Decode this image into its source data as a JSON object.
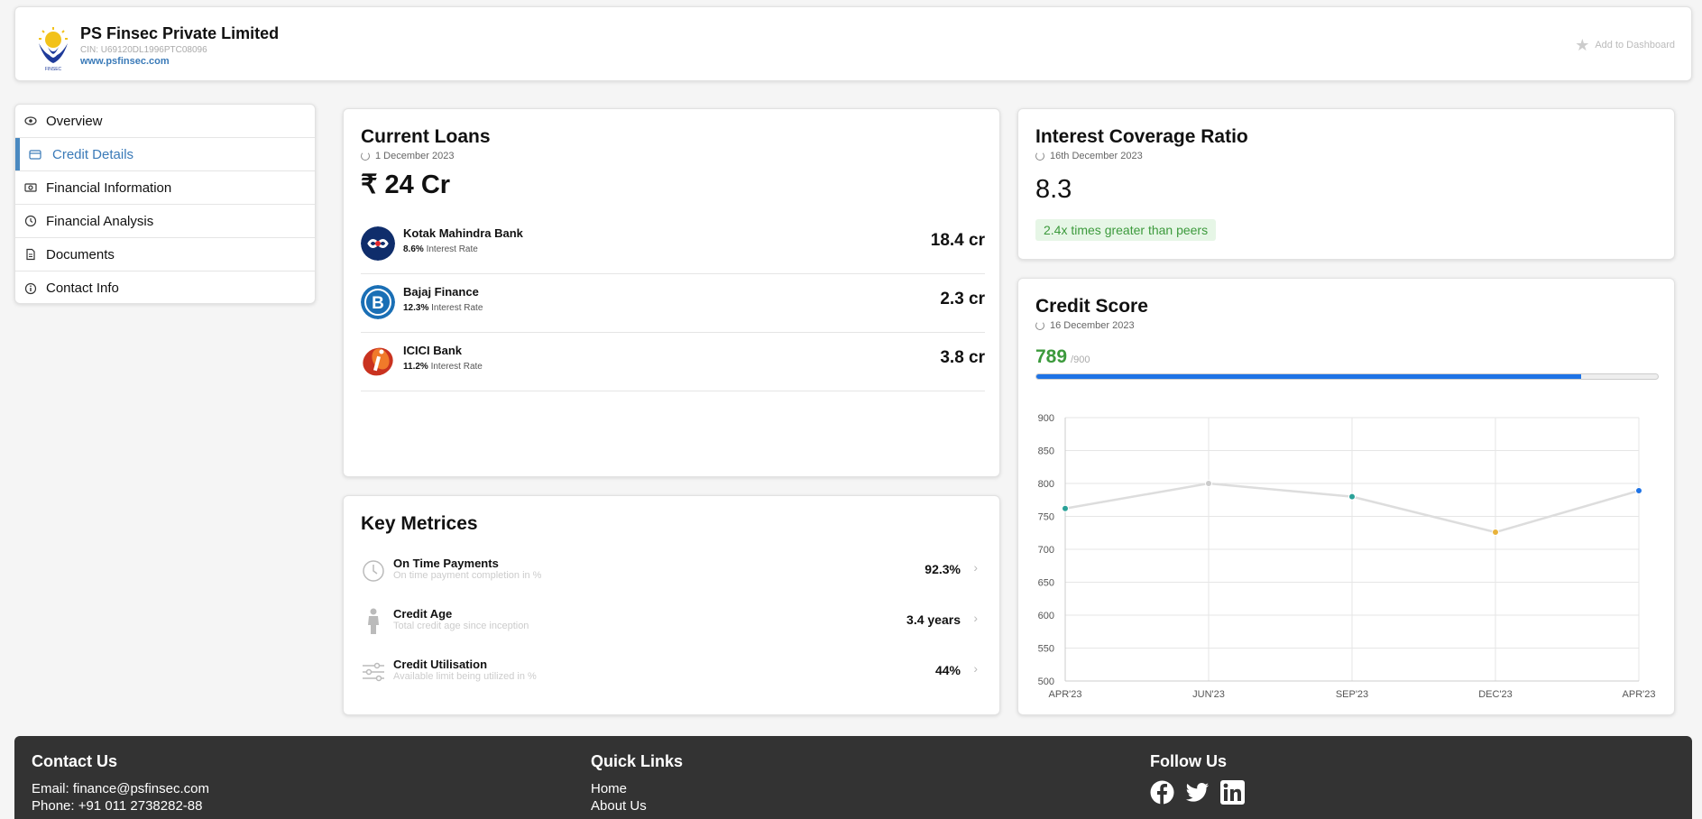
{
  "header": {
    "company_name": "PS Finsec Private Limited",
    "cin": "CIN: U69120DL1996PTC08096",
    "website": "www.psfinsec.com",
    "add_to_dashboard": "Add to Dashboard"
  },
  "sidebar": {
    "items": [
      {
        "label": "Overview",
        "icon": "eye-icon"
      },
      {
        "label": "Credit Details",
        "icon": "credit-card-icon"
      },
      {
        "label": "Financial Information",
        "icon": "money-icon"
      },
      {
        "label": "Financial Analysis",
        "icon": "clock-icon"
      },
      {
        "label": "Documents",
        "icon": "document-icon"
      },
      {
        "label": "Contact Info",
        "icon": "info-icon"
      }
    ],
    "active_index": 1
  },
  "current_loans": {
    "title": "Current Loans",
    "date": "1 December 2023",
    "total": "₹ 24 Cr",
    "loans": [
      {
        "bank": "Kotak Mahindra Bank",
        "rate": "8.6%",
        "rate_label": "Interest Rate",
        "amount": "18.4 cr",
        "color": "#0f2d6b"
      },
      {
        "bank": "Bajaj Finance",
        "rate": "12.3%",
        "rate_label": "Interest Rate",
        "amount": "2.3 cr",
        "color": "#1a6fb5"
      },
      {
        "bank": "ICICI Bank",
        "rate": "11.2%",
        "rate_label": "Interest Rate",
        "amount": "3.8 cr",
        "color": "#b02a1a"
      }
    ]
  },
  "key_metrics": {
    "title": "Key Metrices",
    "items": [
      {
        "name": "On Time Payments",
        "desc": "On time payment completion in %",
        "value": "92.3%",
        "icon": "clock-icon"
      },
      {
        "name": "Credit Age",
        "desc": "Total credit age since inception",
        "value": "3.4 years",
        "icon": "person-icon"
      },
      {
        "name": "Credit Utilisation",
        "desc": "Available limit being utilized in %",
        "value": "44%",
        "icon": "sliders-icon"
      }
    ]
  },
  "interest_coverage": {
    "title": "Interest Coverage Ratio",
    "date": "16th December 2023",
    "value": "8.3",
    "badge": "2.4x times greater than peers"
  },
  "credit_score": {
    "title": "Credit Score",
    "date": "16 December 2023",
    "value": "789",
    "max": "/900",
    "fraction": 0.876
  },
  "chart_data": {
    "type": "line",
    "x": [
      "APR'23",
      "JUN'23",
      "SEP'23",
      "DEC'23",
      "APR'23"
    ],
    "values": [
      762,
      800,
      780,
      726,
      789
    ],
    "point_colors": [
      "#2aa198",
      "#cccccc",
      "#2aa198",
      "#e8b23a",
      "#1e73e6"
    ],
    "ylim": [
      500,
      900
    ],
    "yticks": [
      900,
      850,
      800,
      750,
      700,
      650,
      600,
      550,
      500
    ],
    "grid": true
  },
  "footer": {
    "contact_title": "Contact Us",
    "email": "Email: finance@psfinsec.com",
    "phone": "Phone: +91 011 2738282-88",
    "links_title": "Quick Links",
    "links": [
      "Home",
      "About Us"
    ],
    "follow_title": "Follow Us",
    "social": [
      "facebook-icon",
      "twitter-icon",
      "linkedin-icon"
    ]
  }
}
